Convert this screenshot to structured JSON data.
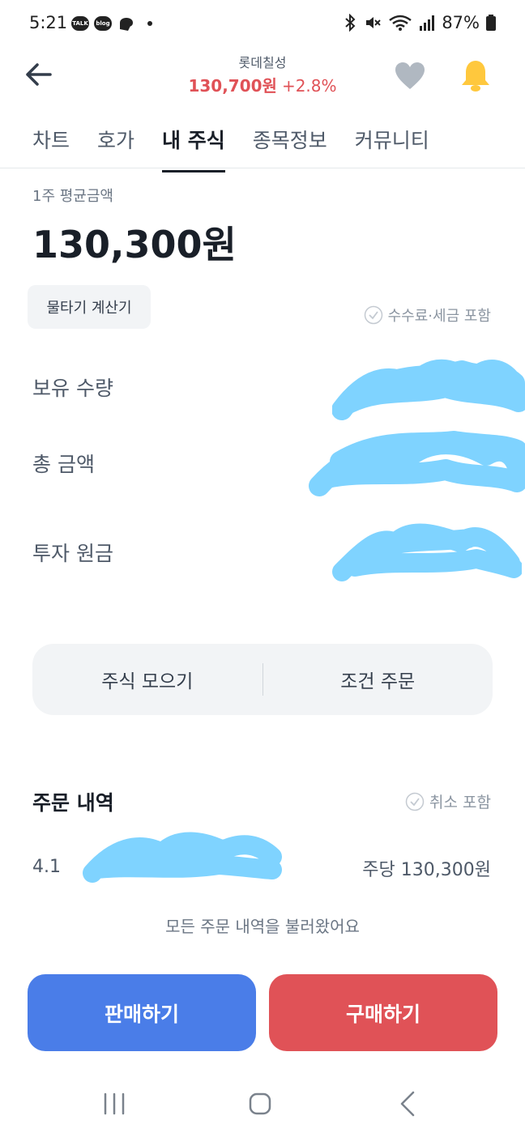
{
  "status_bar": {
    "time": "5:21",
    "talk_label": "TALK",
    "blog_label": "blog",
    "battery": "87%"
  },
  "header": {
    "stock_name": "롯데칠성",
    "price": "130,700원",
    "change": "+2.8%"
  },
  "tabs": [
    {
      "label": "차트"
    },
    {
      "label": "호가"
    },
    {
      "label": "내 주식"
    },
    {
      "label": "종목정보"
    },
    {
      "label": "커뮤니티"
    }
  ],
  "avg": {
    "label": "1주 평균금액",
    "value": "130,300원"
  },
  "calc_button": "물타기 계산기",
  "fee_label": "수수료·세금 포함",
  "rows": {
    "quantity": "보유 수량",
    "total": "총 금액",
    "principal": "투자 원금"
  },
  "actions": {
    "collect": "주식 모으기",
    "conditional": "조건 주문"
  },
  "orders": {
    "title": "주문 내역",
    "cancel_label": "취소 포함",
    "items": [
      {
        "date": "4.1",
        "price": "주당 130,300원"
      }
    ],
    "loaded_message": "모든 주문 내역을 불러왔어요"
  },
  "buttons": {
    "sell": "판매하기",
    "buy": "구매하기"
  },
  "colors": {
    "up": "#e05257",
    "sell": "#4a7de8",
    "buy": "#e05257",
    "redaction": "#7fd3ff"
  }
}
